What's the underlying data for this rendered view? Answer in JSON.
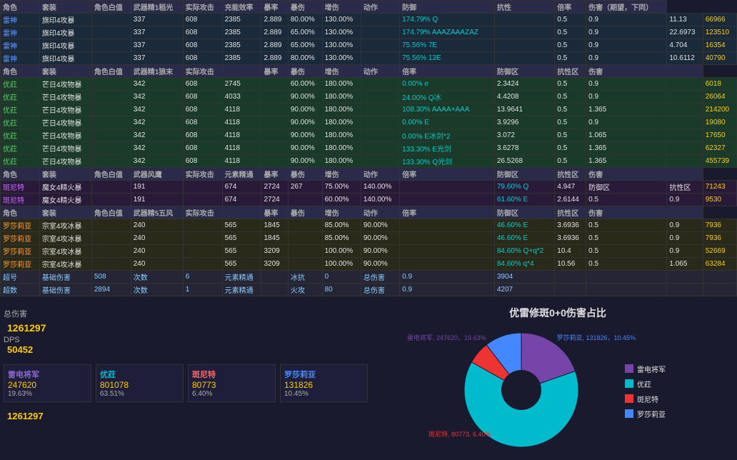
{
  "title": "优雷修斑0+0伤害占比",
  "table": {
    "headers_main": [
      "角色",
      "套装",
      "角色白值",
      "武器精1稻光",
      "实际攻击",
      "充能效率",
      "暴率",
      "暴伤",
      "增伤",
      "动作",
      "防御",
      "抗性",
      "倍率",
      "伤害（期望，下同）"
    ],
    "headers_youzi": [
      "角色",
      "套装",
      "角色白值",
      "武器精1狼末",
      "实际攻击",
      "暴率",
      "暴伤",
      "增伤",
      "动作",
      "倍率",
      "防御区",
      "抗性区",
      "伤害"
    ],
    "headers_banni": [
      "角色",
      "套装",
      "角色白值",
      "武器风鹰",
      "实际攻击",
      "元素精通",
      "暴率",
      "暴伤",
      "增伤",
      "动作",
      "倍率",
      "防御区",
      "抗性区",
      "伤害"
    ],
    "headers_luo": [
      "角色",
      "套装",
      "角色白值",
      "武器精5五风",
      "实际攻击",
      "暴率",
      "暴伤",
      "增伤",
      "动作",
      "倍率",
      "防御区",
      "抗性区",
      "伤害"
    ],
    "sections": [
      {
        "char": "雷电",
        "rows": [
          [
            "雷神",
            "旗印4攻暴",
            "",
            "337",
            "608",
            "2385",
            "2.889",
            "80.00%",
            "130.00%",
            "",
            "174.79% Q",
            "",
            "0.5",
            "0.9",
            "11.13",
            "66966"
          ],
          [
            "雷神",
            "旗印4攻暴",
            "",
            "337",
            "608",
            "2385",
            "2.889",
            "65.00%",
            "130.00%",
            "",
            "174.79% AAAZAAAZAZ",
            "",
            "0.5",
            "0.9",
            "22.6973",
            "123510"
          ],
          [
            "雷神",
            "旗印4攻暴",
            "",
            "337",
            "608",
            "2385",
            "2.889",
            "65.00%",
            "130.00%",
            "",
            "75.56% 7E",
            "",
            "0.5",
            "0.9",
            "4.704",
            "16354"
          ],
          [
            "雷神",
            "旗印4攻暴",
            "",
            "337",
            "608",
            "2385",
            "2.889",
            "80.00%",
            "130.00%",
            "",
            "75.56% 13E",
            "",
            "0.5",
            "0.9",
            "10.6112",
            "40790"
          ]
        ]
      },
      {
        "char": "优荭",
        "rows": [
          [
            "优荭",
            "芒日4攻物暴",
            "",
            "342",
            "608",
            "2745",
            "",
            "60.00%",
            "180.00%",
            "",
            "0.00% e",
            "2.3424",
            "0.5",
            "0.9",
            "",
            "6018"
          ],
          [
            "优荭",
            "芒日4攻物暴",
            "",
            "342",
            "608",
            "4033",
            "",
            "90.00%",
            "180.00%",
            "",
            "24.00% Q冰",
            "4.4208",
            "0.5",
            "0.9",
            "",
            "26064"
          ],
          [
            "优荭",
            "芒日4攻物暴",
            "",
            "342",
            "608",
            "4118",
            "",
            "90.00%",
            "180.00%",
            "",
            "108.30% AAAA+AAA",
            "13.9641",
            "0.5",
            "1.365",
            "",
            "214200"
          ],
          [
            "优荭",
            "芒日4攻物暴",
            "",
            "342",
            "608",
            "4118",
            "",
            "90.00%",
            "180.00%",
            "",
            "0.00% E",
            "3.9296",
            "0.5",
            "0.9",
            "",
            "19080"
          ],
          [
            "优荭",
            "芒日4攻物暴",
            "",
            "342",
            "608",
            "4118",
            "",
            "90.00%",
            "180.00%",
            "",
            "0.00% E冰剑*2",
            "3.072",
            "0.5",
            "1.065",
            "",
            "17650"
          ],
          [
            "优荭",
            "芒日4攻物暴",
            "",
            "342",
            "608",
            "4118",
            "",
            "90.00%",
            "180.00%",
            "",
            "133.30% E光剑",
            "3.6278",
            "0.5",
            "1.365",
            "",
            "62327"
          ],
          [
            "优荭",
            "芒日4攻物暴",
            "",
            "342",
            "608",
            "4118",
            "",
            "90.00%",
            "180.00%",
            "",
            "133.30% Q光剑",
            "26.5268",
            "0.5",
            "1.365",
            "",
            "455739"
          ]
        ]
      },
      {
        "char": "斑尼特",
        "rows": [
          [
            "斑尼特",
            "魔女4精火暴",
            "",
            "191",
            "",
            "674",
            "2724",
            "267",
            "75.00%",
            "140.00%",
            "",
            "79.60% Q",
            "4.947",
            "防御区",
            "抗性区",
            "71243"
          ],
          [
            "斑尼特",
            "魔女4精火暴",
            "",
            "191",
            "",
            "674",
            "2724",
            "",
            "60.00%",
            "140.00%",
            "",
            "61.60% E",
            "2.6144",
            "0.5",
            "0.9",
            "9530"
          ]
        ]
      },
      {
        "char": "罗莎莉亚",
        "rows": [
          [
            "罗莎莉亚",
            "宗室4攻冰暴",
            "",
            "240",
            "",
            "565",
            "1845",
            "",
            "85.00%",
            "90.00%",
            "",
            "46.60% E",
            "3.6936",
            "0.5",
            "0.9",
            "7936"
          ],
          [
            "罗莎莉亚",
            "宗室4攻冰暴",
            "",
            "240",
            "",
            "565",
            "1845",
            "",
            "85.00%",
            "90.00%",
            "",
            "46.60% E",
            "3.6936",
            "0.5",
            "0.9",
            "7936"
          ],
          [
            "罗莎莉亚",
            "宗室4攻冰暴",
            "",
            "240",
            "",
            "565",
            "3209",
            "",
            "100.00%",
            "90.00%",
            "",
            "84.60% Q+q*2",
            "10.4",
            "0.5",
            "0.9",
            "52669"
          ],
          [
            "罗莎莉亚",
            "宗室4攻冰暴",
            "",
            "240",
            "",
            "565",
            "3209",
            "",
            "100.00%",
            "90.00%",
            "",
            "84.60% q*4",
            "10.56",
            "0.5",
            "1.065",
            "63284"
          ]
        ]
      }
    ],
    "subtotals": [
      {
        "char": "超号",
        "base_dmg": "508",
        "count": "6",
        "element_bonus": "元素精通",
        "ice_res": "冰抗",
        "fire_res": "0",
        "res_val": "0.9",
        "total": "3904"
      },
      {
        "char": "超数",
        "base_dmg": "2894",
        "count": "1",
        "element_bonus": "元素精通",
        "fire_atk": "火攻",
        "res_val": "80",
        "total_val": "0.9",
        "total": "4207"
      }
    ]
  },
  "summary": {
    "total_damage_label": "总伤害",
    "total_damage": "1261297",
    "dps_label": "DPS",
    "dps": "50452",
    "characters": [
      {
        "name": "雷电将军",
        "damage": "247620",
        "percent": "19.63%",
        "color": "#7744aa"
      },
      {
        "name": "优荭",
        "damage": "801078",
        "percent": "63.51%",
        "color": "#00bbcc"
      },
      {
        "name": "斑尼特",
        "damage": "80773",
        "percent": "6.40%",
        "color": "#ff4444"
      },
      {
        "name": "罗莎莉亚",
        "damage": "131826",
        "percent": "10.45%",
        "color": "#4488ff"
      }
    ],
    "grand_total": "1261297"
  },
  "chart": {
    "title": "优雷修斑0+0伤害占比",
    "segments": [
      {
        "name": "雷电将军",
        "value": 247620,
        "pct": 19.63,
        "color": "#7744aa"
      },
      {
        "name": "优荭",
        "value": 801078,
        "pct": 63.51,
        "color": "#00bbcc"
      },
      {
        "name": "斑尼特",
        "value": 80773,
        "pct": 6.4,
        "color": "#ee3333"
      },
      {
        "name": "罗莎莉亚",
        "value": 131826,
        "pct": 10.45,
        "color": "#4488ff"
      }
    ],
    "labels": {
      "luo": "罗莎莉亚, 131826，10.45%",
      "lei": "雷电将军, 247620，19.63%",
      "ban": "斑尼特, 80773, 6.40%",
      "you": "优荭, 801078, 63.51%"
    }
  }
}
